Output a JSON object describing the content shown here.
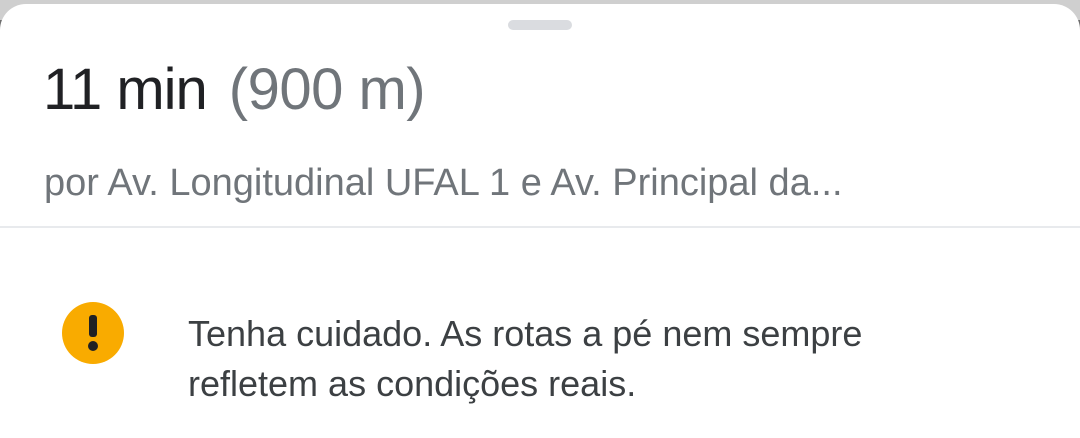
{
  "route": {
    "duration": "11 min",
    "distance": "(900 m)",
    "via": "por Av. Longitudinal UFAL 1 e Av. Principal da..."
  },
  "warning": {
    "icon": "warning-icon",
    "color": "#f9ab00",
    "line1": "Tenha cuidado. As rotas a pé nem sempre",
    "line2": "refletem as condições reais."
  }
}
